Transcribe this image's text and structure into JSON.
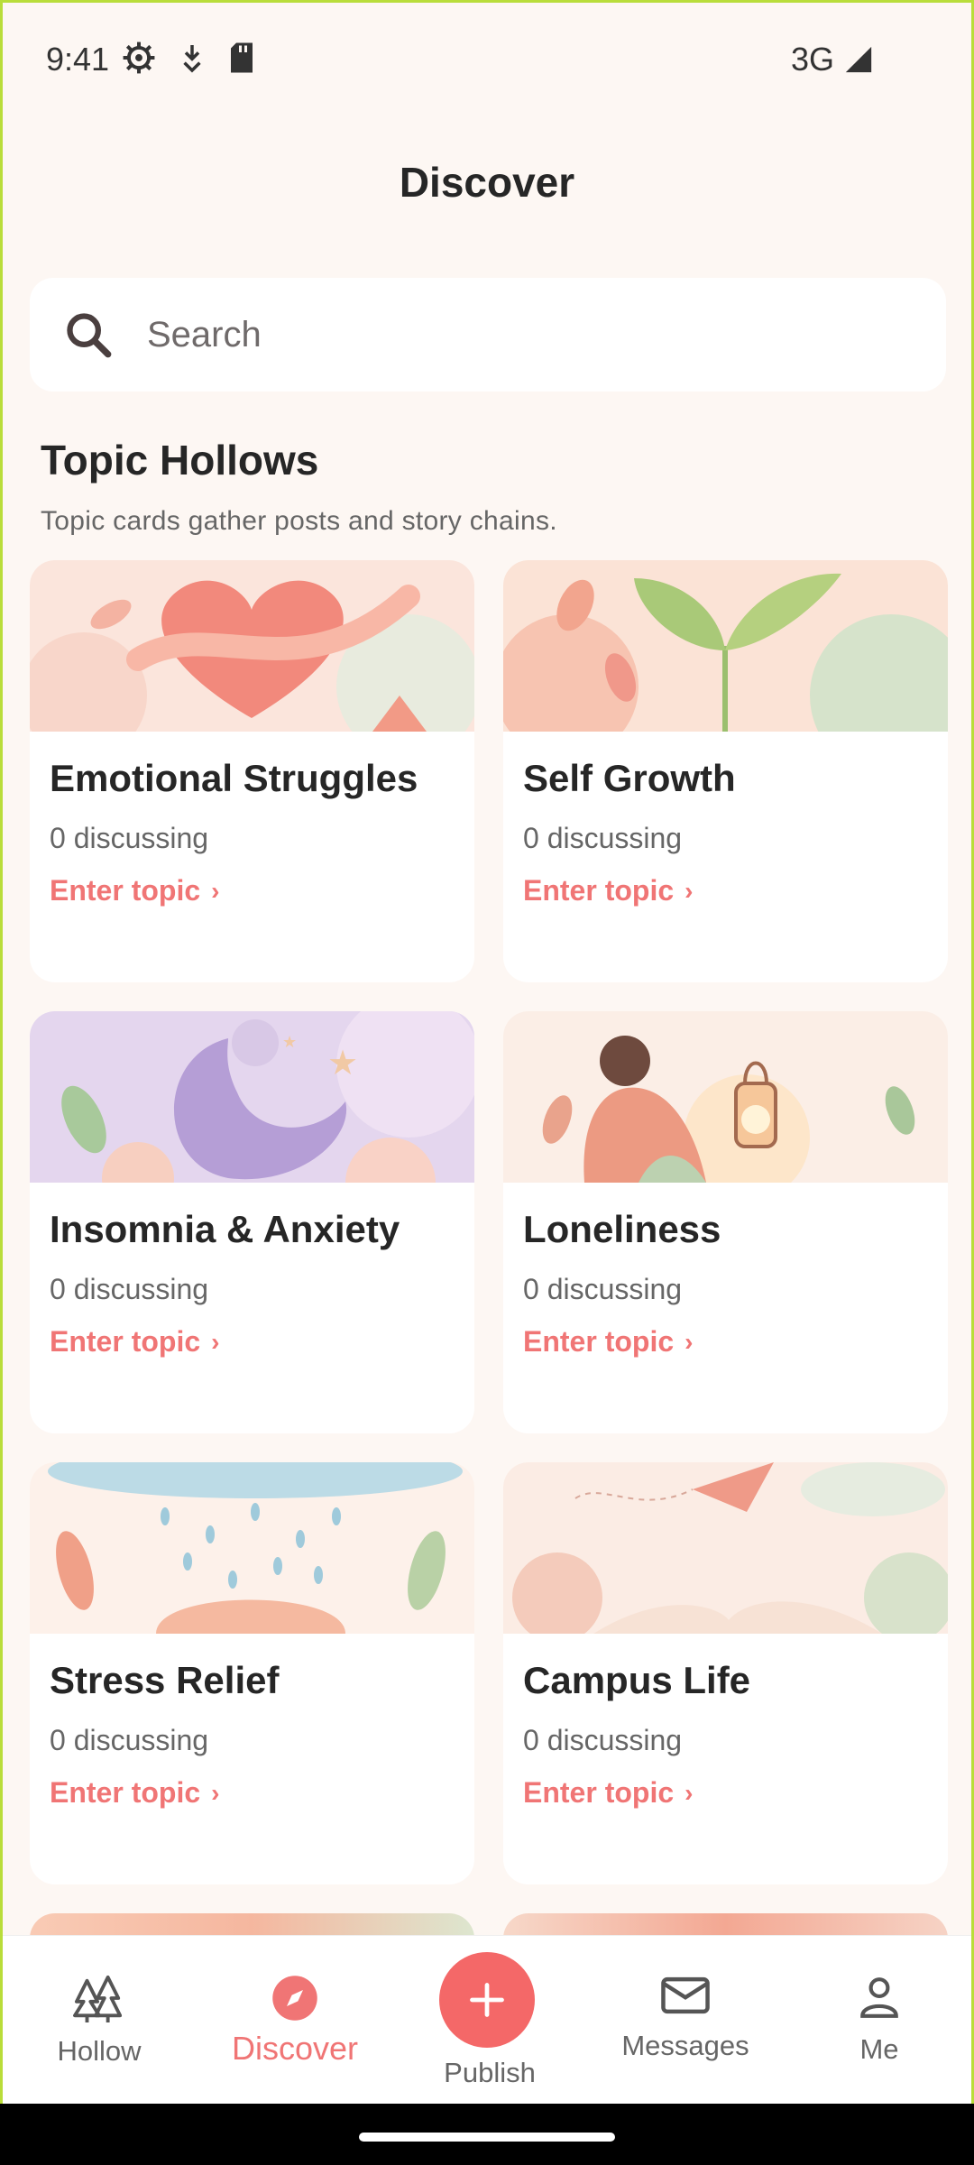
{
  "status_bar": {
    "time": "9:41",
    "icons": [
      "settings-icon",
      "download-icon",
      "sd-card-icon"
    ],
    "network": "3G",
    "signal_icon": "signal-icon"
  },
  "header": {
    "title": "Discover"
  },
  "search": {
    "placeholder": "Search",
    "icon": "search-icon"
  },
  "section": {
    "title": "Topic Hollows",
    "subtitle": "Topic cards gather posts and story chains."
  },
  "cards": [
    {
      "title": "Emotional Struggles",
      "count": "0 discussing",
      "link": "Enter topic",
      "art": "heart-ribbon"
    },
    {
      "title": "Self Growth",
      "count": "0 discussing",
      "link": "Enter topic",
      "art": "sprout"
    },
    {
      "title": "Insomnia & Anxiety",
      "count": "0 discussing",
      "link": "Enter topic",
      "art": "sleeping-moon"
    },
    {
      "title": "Loneliness",
      "count": "0 discussing",
      "link": "Enter topic",
      "art": "girl-lantern"
    },
    {
      "title": "Stress Relief",
      "count": "0 discussing",
      "link": "Enter topic",
      "art": "rain-cloud"
    },
    {
      "title": "Campus Life",
      "count": "0 discussing",
      "link": "Enter topic",
      "art": "paper-plane-book"
    }
  ],
  "bottom_nav": {
    "items": [
      {
        "label": "Hollow",
        "icon": "trees-icon"
      },
      {
        "label": "Discover",
        "icon": "compass-icon",
        "active": true
      },
      {
        "label": "Publish",
        "icon": "plus-icon"
      },
      {
        "label": "Messages",
        "icon": "mail-icon"
      },
      {
        "label": "Me",
        "icon": "person-icon"
      }
    ]
  },
  "colors": {
    "accent": "#f07575",
    "background": "#fdf7f3",
    "card": "#ffffff",
    "text": "#262626"
  }
}
